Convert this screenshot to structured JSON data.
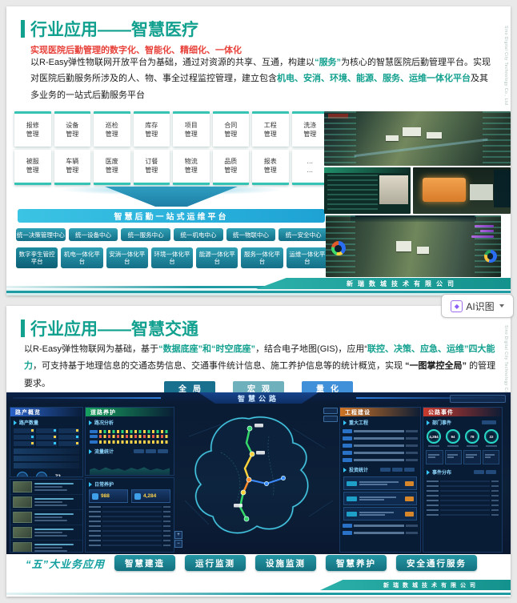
{
  "company_ribbon": "新瑞数城技术有限公司",
  "side_text": "Sino Digital City Technology Co., Ltd",
  "ai_button": {
    "label": "AI识图"
  },
  "slide1": {
    "title": "行业应用——智慧医疗",
    "subtitle": "实现医院后勤管理的数字化、智能化、精细化、一体化",
    "body": {
      "s1": "以R-Easy弹性物联网开放平台为基础，通过对资源的共享、互通，构建以",
      "s2": "“服务”",
      "s3": "为核心的智慧医院后勤管理平台。实现对医院后勤服务所涉及的人、物、事全过程监控管理，建立包含",
      "s4": "机电、安消、环境、能源、服务、运维一体化平台",
      "s5": "及其多业务的一站式后勤服务平台"
    },
    "modules": [
      {
        "l1": "报修",
        "l2": "管理"
      },
      {
        "l1": "设备",
        "l2": "管理"
      },
      {
        "l1": "巡检",
        "l2": "管理"
      },
      {
        "l1": "库存",
        "l2": "管理"
      },
      {
        "l1": "项目",
        "l2": "管理"
      },
      {
        "l1": "合同",
        "l2": "管理"
      },
      {
        "l1": "工程",
        "l2": "管理"
      },
      {
        "l1": "洗涤",
        "l2": "管理"
      },
      {
        "l1": "被服",
        "l2": "管理"
      },
      {
        "l1": "车辆",
        "l2": "管理"
      },
      {
        "l1": "医废",
        "l2": "管理"
      },
      {
        "l1": "订餐",
        "l2": "管理"
      },
      {
        "l1": "物流",
        "l2": "管理"
      },
      {
        "l1": "品质",
        "l2": "管理"
      },
      {
        "l1": "报表",
        "l2": "管理"
      },
      {
        "l1": "…",
        "l2": "…"
      }
    ],
    "funnel_label": "智慧后勤一站式运维平台",
    "centers": [
      "统一决策管理中心",
      "统一设备中心",
      "统一服务中心",
      "统一机电中心",
      "统一物联中心",
      "统一安全中心"
    ],
    "platforms": [
      "数字孪生管控平台",
      "机电一体化平台",
      "安消一体化平台",
      "环境一体化平台",
      "能源一体化平台",
      "服务一体化平台",
      "运维一体化平台"
    ]
  },
  "slide2": {
    "title": "行业应用——智慧交通",
    "body": {
      "s1": "以R-Easy弹性物联网为基础，基于",
      "s2": "“数据底座”和“时空底座”",
      "s3": "，结合电子地图(GIS)，应用“",
      "s4": "联控、决策、应急、运维”四大能力",
      "s5": "，可支持基于地理信息的交通态势信息、交通事件统计信息、施工养护信息等的统计概览，实现 ",
      "s6": "“一图掌控全局”",
      "s7": " 的管理要求。"
    },
    "view_buttons": [
      "全局",
      "宏观",
      "量化"
    ],
    "dashboard": {
      "title": "智慧公路",
      "panel_assets": {
        "title": "路产概览",
        "sub": "路产数量",
        "stat": "72"
      },
      "panel_condition": {
        "title": "道路养护",
        "sub1": "路况分析",
        "sub2": "流量统计"
      },
      "panel_daily": {
        "title": "日常养护",
        "stat1": "988",
        "stat2": "4,284"
      },
      "panel_projects": {
        "title": "工程建设",
        "sub1": "重大工程",
        "sub2": "投资统计"
      },
      "panel_events": {
        "title": "公路事件",
        "sub1": "部门事件",
        "sub2": "事件分布",
        "gauges": [
          "4,284",
          "94",
          "78",
          "22"
        ]
      }
    },
    "biz_label": "“五”大业务应用",
    "biz_buttons": [
      "智慧建造",
      "运行监测",
      "设施监测",
      "智慧养护",
      "安全通行服务"
    ]
  }
}
